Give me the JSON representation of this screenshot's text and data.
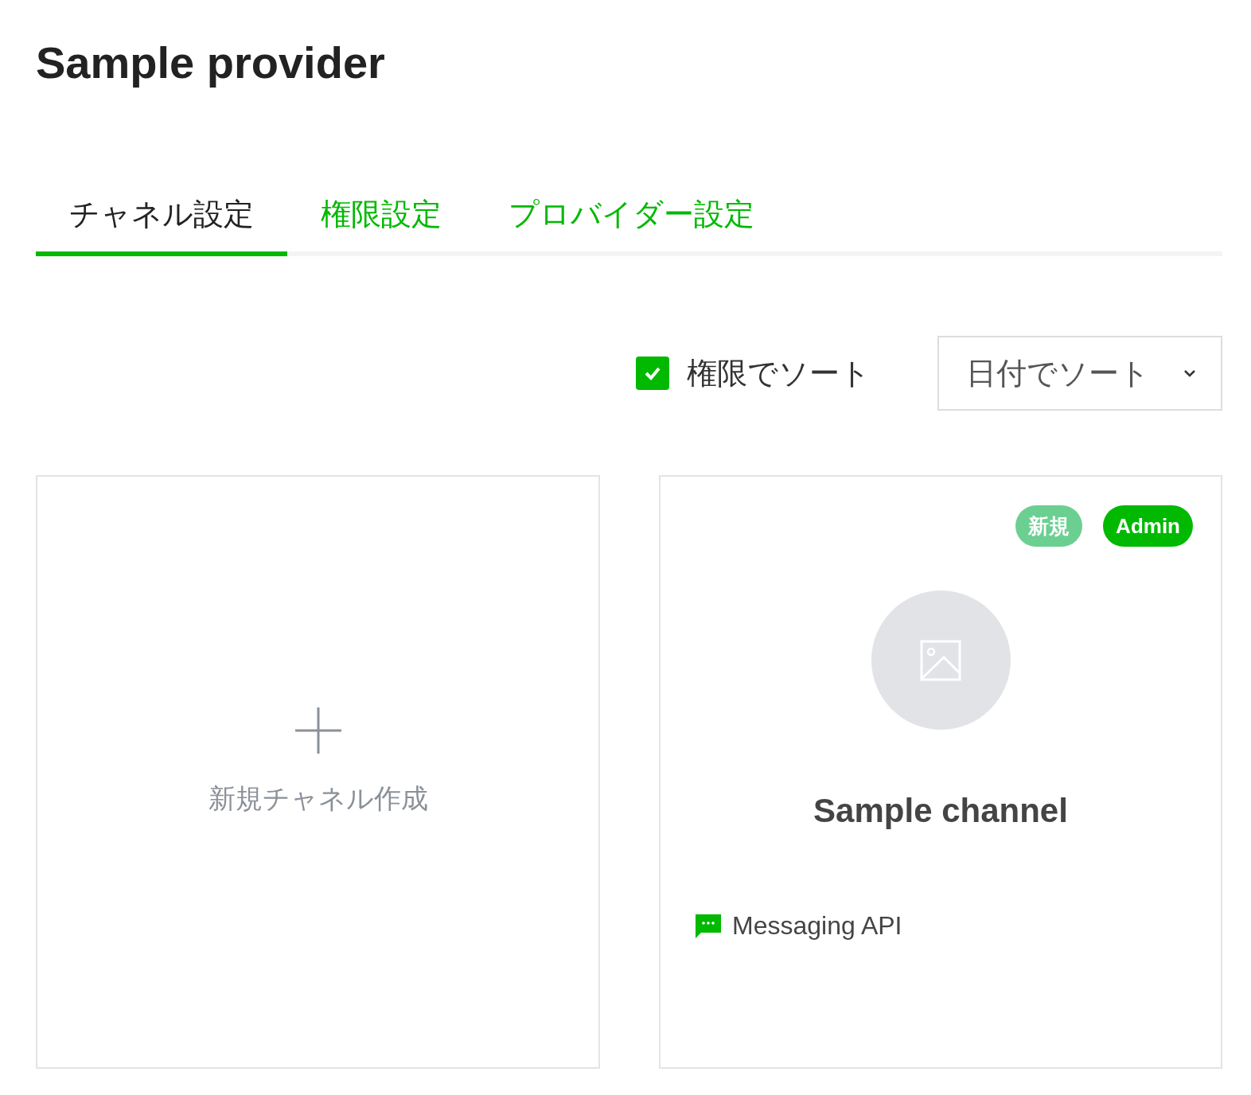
{
  "title": "Sample provider",
  "tabs": [
    {
      "label": "チャネル設定",
      "selected": true
    },
    {
      "label": "権限設定",
      "selected": false
    },
    {
      "label": "プロバイダー設定",
      "selected": false
    }
  ],
  "sort_checkbox": {
    "label": "権限でソート",
    "checked": true
  },
  "sort_select": {
    "value": "日付でソート"
  },
  "cards": [
    {
      "kind": "create",
      "label": "新規チャネル作成"
    },
    {
      "kind": "channel",
      "badges": [
        {
          "label": "新規",
          "color": "#6ccf92"
        },
        {
          "label": "Admin",
          "color": "#00b900"
        }
      ],
      "name": "Sample channel",
      "type_label": "Messaging API"
    }
  ]
}
